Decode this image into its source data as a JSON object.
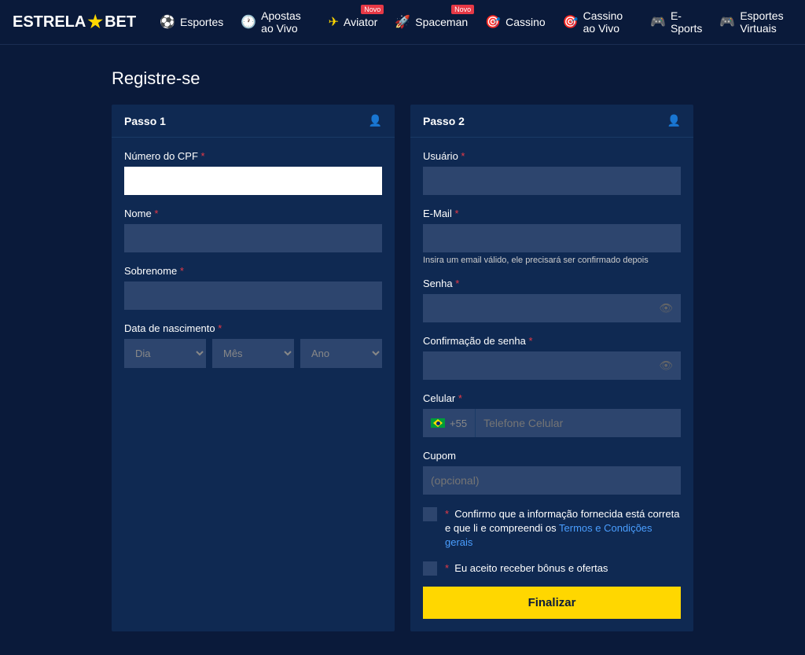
{
  "brand": {
    "part1": "ESTRELA",
    "part2": "BET"
  },
  "nav": {
    "esportes": "Esportes",
    "apostas": "Apostas ao Vivo",
    "aviator": "Aviator",
    "spaceman": "Spaceman",
    "cassino": "Cassino",
    "cassino_vivo": "Cassino ao Vivo",
    "esports": "E-Sports",
    "virtuais": "Esportes Virtuais",
    "badge_novo": "Novo"
  },
  "page": {
    "title": "Registre-se"
  },
  "step1": {
    "title": "Passo 1",
    "cpf": "Número do CPF",
    "nome": "Nome",
    "sobrenome": "Sobrenome",
    "nascimento": "Data de nascimento",
    "dia": "Dia",
    "mes": "Mês",
    "ano": "Ano"
  },
  "step2": {
    "title": "Passo 2",
    "usuario": "Usuário",
    "email": "E-Mail",
    "email_hint": "Insira um email válido, ele precisará ser confirmado depois",
    "senha": "Senha",
    "conf_senha": "Confirmação de senha",
    "celular": "Celular",
    "prefix": "+55",
    "phone_placeholder": "Telefone Celular",
    "cupom": "Cupom",
    "cupom_placeholder": "(opcional)",
    "terms_pre": "Confirmo que a informação fornecida está correta e que li e compreendi os ",
    "terms_link": "Termos e Condições gerais",
    "bonus": "Eu aceito receber bônus e ofertas",
    "finalizar": "Finalizar"
  }
}
